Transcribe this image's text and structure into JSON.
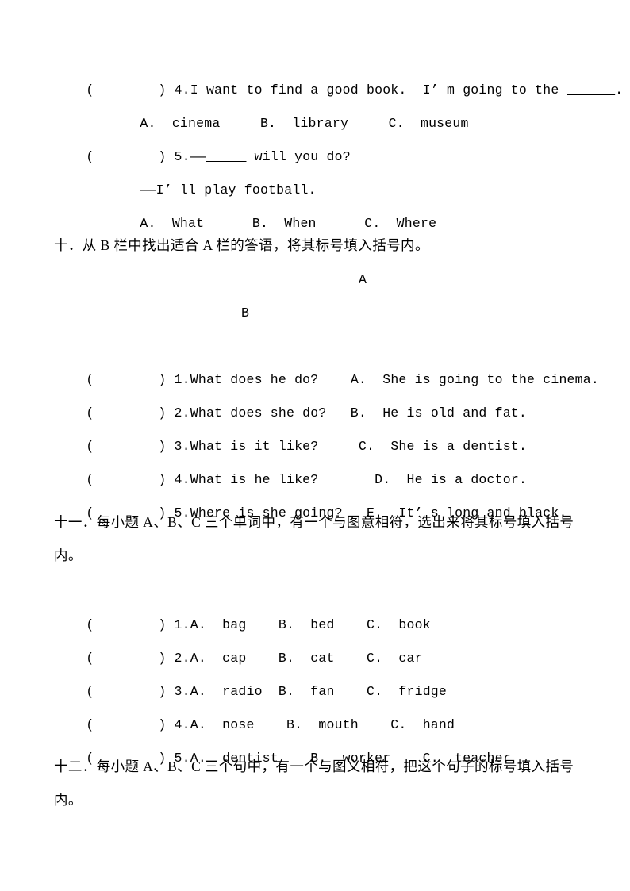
{
  "document": {
    "page_background": "#ffffff",
    "text_color": "#000000",
    "language": "zh-CN / en"
  },
  "section_nine_tail": {
    "q4": {
      "bracket": "(        ) 4.",
      "text": "I want to find a good book.  I’ m going to the ",
      "blank": "______",
      "tail": "."
    },
    "q4_options": "A.  cinema     B.  library     C.  museum",
    "q5": {
      "bracket": "(        ) 5.",
      "text": "——",
      "blank": "_____",
      "tail": " will you do?"
    },
    "q5_answer": "——I’ ll play football.",
    "q5_options": "A.  What      B.  When      C.  Where"
  },
  "section_ten": {
    "heading": "十．从 B 栏中找出适合 A 栏的答语，将其标号填入括号内。",
    "col_a_label": "A",
    "col_b_label": "B",
    "items": [
      {
        "bracket": "(        ) 1.",
        "question": "What does he do?",
        "gap": "    ",
        "answer": "A.  She is going to the cinema."
      },
      {
        "bracket": "(        ) 2.",
        "question": "What does she do?",
        "gap": "   ",
        "answer": "B.  He is old and fat."
      },
      {
        "bracket": "(        ) 3.",
        "question": "What is it like?",
        "gap": "     ",
        "answer": "C.  She is a dentist."
      },
      {
        "bracket": "(        ) 4.",
        "question": "What is he like?",
        "gap": "       ",
        "answer": "D.  He is a doctor."
      },
      {
        "bracket": "(        ) 5.",
        "question": "Where is she going?",
        "gap": "   ",
        "answer": "E.  It’ s long and black."
      }
    ]
  },
  "section_eleven": {
    "heading": "十一．每小题 A、B、C 三个单词中，有一个与图意相符，选出来将其标号填入括号内。",
    "items": [
      {
        "bracket": "(        ) 1.",
        "options": "A.  bag    B.  bed    C.  book"
      },
      {
        "bracket": "(        ) 2.",
        "options": "A.  cap    B.  cat    C.  car"
      },
      {
        "bracket": "(        ) 3.",
        "options": "A.  radio  B.  fan    C.  fridge"
      },
      {
        "bracket": "(        ) 4.",
        "options": "A.  nose    B.  mouth    C.  hand"
      },
      {
        "bracket": "(        ) 5.",
        "options": "A.  dentist    B.  worker    C.  teacher"
      }
    ]
  },
  "section_twelve": {
    "heading": "十二．每小题 A、B、C 三个句中，有一个与图义相符，把这个句子的标号填入括号内。"
  }
}
